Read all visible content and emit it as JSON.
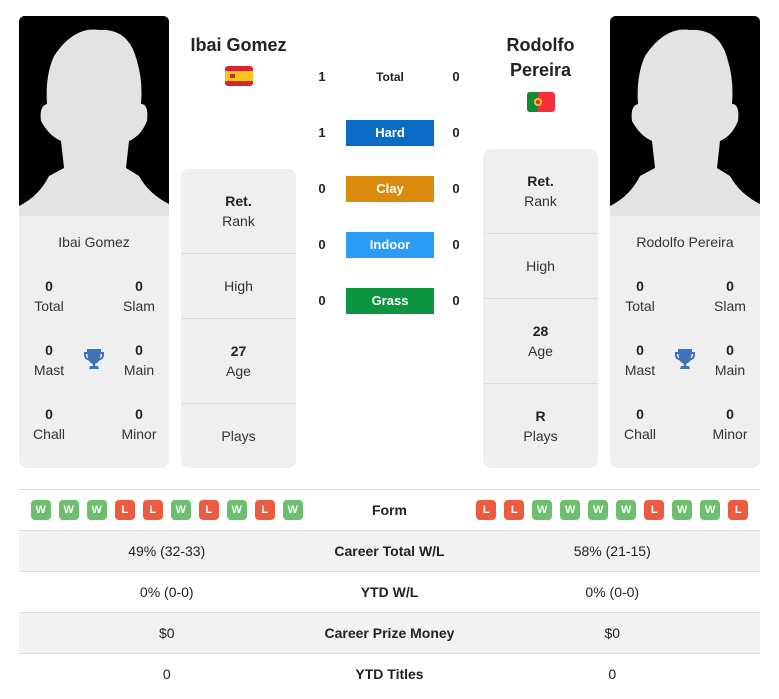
{
  "player1": {
    "name": "Ibai Gomez",
    "country": "Spain",
    "flag_icon": "spain-flag-icon",
    "titles": {
      "total": {
        "value": "0",
        "label": "Total"
      },
      "slam": {
        "value": "0",
        "label": "Slam"
      },
      "mast": {
        "value": "0",
        "label": "Mast"
      },
      "main": {
        "value": "0",
        "label": "Main"
      },
      "chall": {
        "value": "0",
        "label": "Chall"
      },
      "minor": {
        "value": "0",
        "label": "Minor"
      }
    },
    "info": {
      "rank": {
        "value": "Ret.",
        "label": "Rank"
      },
      "high": {
        "value": "",
        "label": "High"
      },
      "age": {
        "value": "27",
        "label": "Age"
      },
      "plays": {
        "value": "",
        "label": "Plays"
      }
    },
    "form": [
      "W",
      "W",
      "W",
      "L",
      "L",
      "W",
      "L",
      "W",
      "L",
      "W"
    ],
    "career_total_wl": "49% (32-33)",
    "ytd_wl": "0% (0-0)",
    "career_prize_money": "$0",
    "ytd_titles": "0"
  },
  "player2": {
    "name_line1": "Rodolfo",
    "name_line2": "Pereira",
    "name": "Rodolfo Pereira",
    "country": "Portugal",
    "flag_icon": "portugal-flag-icon",
    "titles": {
      "total": {
        "value": "0",
        "label": "Total"
      },
      "slam": {
        "value": "0",
        "label": "Slam"
      },
      "mast": {
        "value": "0",
        "label": "Mast"
      },
      "main": {
        "value": "0",
        "label": "Main"
      },
      "chall": {
        "value": "0",
        "label": "Chall"
      },
      "minor": {
        "value": "0",
        "label": "Minor"
      }
    },
    "info": {
      "rank": {
        "value": "Ret.",
        "label": "Rank"
      },
      "high": {
        "value": "",
        "label": "High"
      },
      "age": {
        "value": "28",
        "label": "Age"
      },
      "plays": {
        "value": "R",
        "label": "Plays"
      }
    },
    "form": [
      "L",
      "L",
      "W",
      "W",
      "W",
      "W",
      "L",
      "W",
      "W",
      "L"
    ],
    "career_total_wl": "58% (21-15)",
    "ytd_wl": "0% (0-0)",
    "career_prize_money": "$0",
    "ytd_titles": "0"
  },
  "h2h": [
    {
      "label": "Total",
      "p1": "1",
      "p2": "0",
      "color": ""
    },
    {
      "label": "Hard",
      "p1": "1",
      "p2": "0",
      "color": "#0a6cc4"
    },
    {
      "label": "Clay",
      "p1": "0",
      "p2": "0",
      "color": "#da8a0c"
    },
    {
      "label": "Indoor",
      "p1": "0",
      "p2": "0",
      "color": "#2b9bf4"
    },
    {
      "label": "Grass",
      "p1": "0",
      "p2": "0",
      "color": "#0d9440"
    }
  ],
  "comparison": {
    "form_label": "Form",
    "career_total_label": "Career Total W/L",
    "ytd_wl_label": "YTD W/L",
    "prize_label": "Career Prize Money",
    "ytd_titles_label": "YTD Titles"
  },
  "colors": {
    "win": "#6cbf6c",
    "loss": "#ec5a40",
    "trophy": "#3f72b8"
  }
}
